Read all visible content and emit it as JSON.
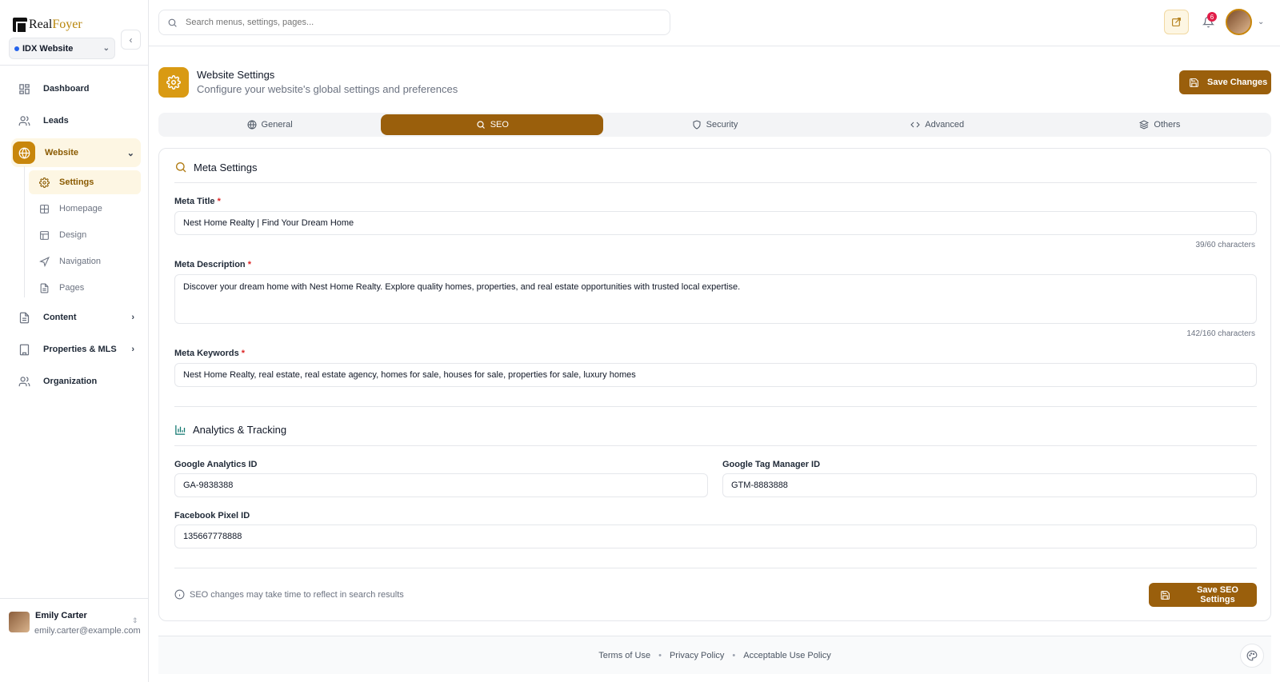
{
  "brand": {
    "name_part1": "Real",
    "name_part2": "Foyer"
  },
  "site_selector": {
    "value": "IDX Website"
  },
  "sidebar": {
    "items": [
      {
        "label": "Dashboard"
      },
      {
        "label": "Leads"
      },
      {
        "label": "Website"
      },
      {
        "label": "Content"
      },
      {
        "label": "Properties & MLS"
      },
      {
        "label": "Organization"
      }
    ],
    "website_sub": [
      {
        "label": "Settings"
      },
      {
        "label": "Homepage"
      },
      {
        "label": "Design"
      },
      {
        "label": "Navigation"
      },
      {
        "label": "Pages"
      }
    ]
  },
  "user": {
    "name": "Emily Carter",
    "email": "emily.carter@example.com"
  },
  "header": {
    "search_placeholder": "Search menus, settings, pages...",
    "notification_count": "6"
  },
  "page": {
    "title": "Website Settings",
    "subtitle": "Configure your website's global settings and preferences",
    "save_label": "Save Changes"
  },
  "tabs": [
    {
      "label": "General",
      "icon": "globe-icon"
    },
    {
      "label": "SEO",
      "icon": "search-icon"
    },
    {
      "label": "Security",
      "icon": "shield-icon"
    },
    {
      "label": "Advanced",
      "icon": "code-icon"
    },
    {
      "label": "Others",
      "icon": "layers-icon"
    }
  ],
  "seo": {
    "meta_section_title": "Meta Settings",
    "meta_title": {
      "label": "Meta Title",
      "required": "*",
      "value": "Nest Home Realty | Find Your Dream Home",
      "counter": "39/60 characters"
    },
    "meta_description": {
      "label": "Meta Description",
      "required": "*",
      "value": "Discover your dream home with Nest Home Realty. Explore quality homes, properties, and real estate opportunities with trusted local expertise.",
      "counter": "142/160 characters"
    },
    "meta_keywords": {
      "label": "Meta Keywords",
      "required": "*",
      "value": "Nest Home Realty, real estate, real estate agency, homes for sale, houses for sale, properties for sale, luxury homes"
    },
    "analytics_section_title": "Analytics & Tracking",
    "google_analytics": {
      "label": "Google Analytics ID",
      "value": "GA-9838388"
    },
    "gtm": {
      "label": "Google Tag Manager ID",
      "value": "GTM-8883888"
    },
    "facebook_pixel": {
      "label": "Facebook Pixel ID",
      "value": "135667778888"
    },
    "note": "SEO changes may take time to reflect in search results",
    "save_label": "Save SEO Settings"
  },
  "footer": {
    "links": [
      "Terms of Use",
      "Privacy Policy",
      "Acceptable Use Policy"
    ],
    "separator": "•"
  },
  "colors": {
    "accent": "#9a5f0c",
    "accent_light": "#fdf6e3",
    "icon_gold": "#d99a13"
  }
}
